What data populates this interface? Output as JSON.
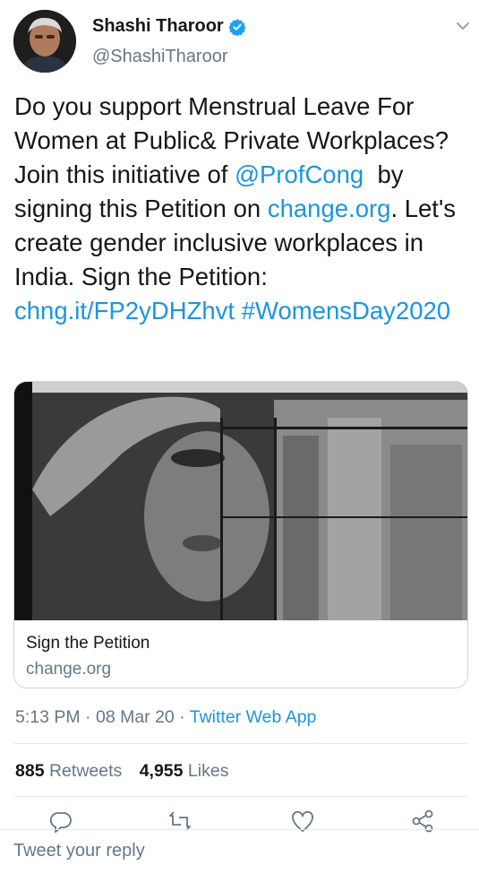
{
  "author": {
    "display_name": "Shashi Tharoor",
    "handle": "@ShashiTharoor",
    "verified_icon": "verified-badge-icon"
  },
  "tweet": {
    "segments": [
      {
        "text": "Do you support Menstrual Leave For Women at Public& Private Workplaces? Join this initiative of ",
        "link": false
      },
      {
        "text": "@ProfCong",
        "link": true
      },
      {
        "text": "  by signing this Petition on ",
        "link": false
      },
      {
        "text": "change.org",
        "link": true
      },
      {
        "text": ". Let's create gender inclusive workplaces in India. Sign the Petition: ",
        "link": false
      },
      {
        "text": "chng.it/FP2yDHZhvt",
        "link": true
      },
      {
        "text": " ",
        "link": false
      },
      {
        "text": "#WomensDay2020",
        "link": true
      }
    ]
  },
  "card": {
    "title": "Sign the Petition",
    "domain": "change.org"
  },
  "meta": {
    "time": "5:13 PM",
    "date": "08 Mar 20",
    "source": "Twitter Web App",
    "separator": " · "
  },
  "stats": {
    "retweets_count": "885",
    "retweets_label": "Retweets",
    "likes_count": "4,955",
    "likes_label": "Likes"
  },
  "actions": [
    "reply-icon",
    "retweet-icon",
    "like-icon",
    "share-icon"
  ],
  "reply": {
    "placeholder": "Tweet your reply"
  },
  "colors": {
    "link": "#1b95e0",
    "secondary_text": "#657786",
    "border": "#ccd6dd"
  }
}
